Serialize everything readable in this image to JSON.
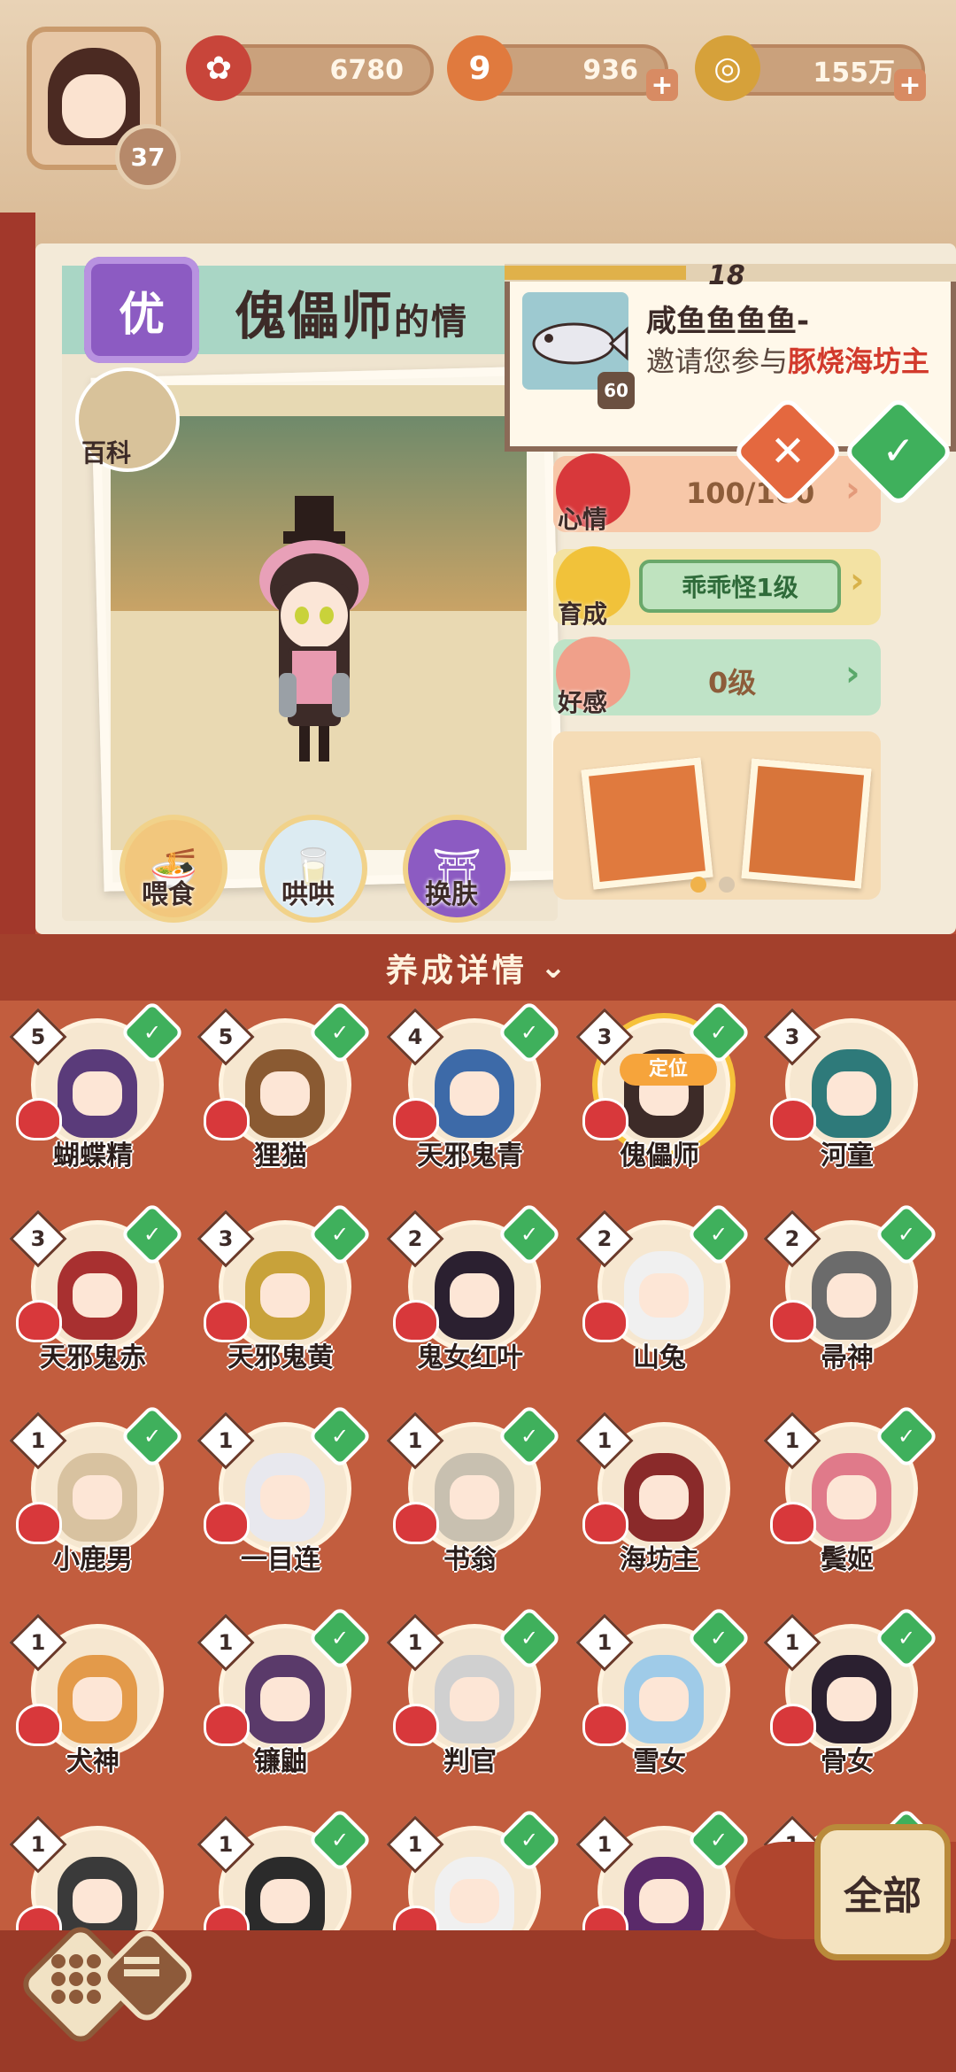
{
  "header": {
    "player_level": "37",
    "resources": [
      {
        "id": "flower",
        "value": "6780",
        "icon": "plum-blossom-icon",
        "color": "#c8453a"
      },
      {
        "id": "nine",
        "value": "936",
        "icon": "nine-badge-icon",
        "color": "#e07a3e"
      },
      {
        "id": "coins",
        "value": "155万",
        "icon": "coin-icon",
        "color": "#d6a13a"
      }
    ]
  },
  "character": {
    "rarity": "优",
    "name": "傀儡师",
    "name_suffix": "的情",
    "encyclopedia": "百科",
    "actions": [
      {
        "label": "喂食",
        "icon": "noodle-bowl-icon",
        "color": "#f2c77d"
      },
      {
        "label": "哄哄",
        "icon": "milk-carton-icon",
        "color": "#dcebf2"
      },
      {
        "label": "换肤",
        "icon": "kimono-icon",
        "color": "#8c5bc2"
      }
    ]
  },
  "notification": {
    "count": "18",
    "avatar_level": "60",
    "sender": "咸鱼鱼鱼鱼-",
    "message_prefix": "邀请您参与",
    "message_highlight": "豚烧海坊主",
    "decline_label": "✕",
    "accept_label": "✓"
  },
  "stats": {
    "mood": {
      "label": "心情",
      "value": "100/100"
    },
    "growth": {
      "label": "育成",
      "value": "乖乖怪1级"
    },
    "affection": {
      "label": "好感",
      "value": "0级"
    }
  },
  "expand_label": "养成详情",
  "locate_label": "定位",
  "roster": [
    {
      "name": "蝴蝶精",
      "stars": "5",
      "checked": true,
      "color": "#5a3b7a"
    },
    {
      "name": "狸猫",
      "stars": "5",
      "checked": true,
      "color": "#8a5a32"
    },
    {
      "name": "天邪鬼青",
      "stars": "4",
      "checked": true,
      "color": "#3d6aa8"
    },
    {
      "name": "傀儡师",
      "stars": "3",
      "checked": true,
      "color": "#3d2b28"
    },
    {
      "name": "河童",
      "stars": "3",
      "checked": false,
      "color": "#2e7a7a"
    },
    {
      "name": "天邪鬼赤",
      "stars": "3",
      "checked": true,
      "color": "#a83030"
    },
    {
      "name": "天邪鬼黄",
      "stars": "3",
      "checked": true,
      "color": "#c8a23a"
    },
    {
      "name": "鬼女红叶",
      "stars": "2",
      "checked": true,
      "color": "#2b2030"
    },
    {
      "name": "山兔",
      "stars": "2",
      "checked": true,
      "color": "#f0f0f0"
    },
    {
      "name": "帚神",
      "stars": "2",
      "checked": true,
      "color": "#6b6b6b"
    },
    {
      "name": "小鹿男",
      "stars": "1",
      "checked": true,
      "color": "#d8c2a0"
    },
    {
      "name": "一目连",
      "stars": "1",
      "checked": true,
      "color": "#e8e8ee"
    },
    {
      "name": "书翁",
      "stars": "1",
      "checked": true,
      "color": "#c8c0b0"
    },
    {
      "name": "海坊主",
      "stars": "1",
      "checked": false,
      "color": "#8a2a2a"
    },
    {
      "name": "鬓姬",
      "stars": "1",
      "checked": true,
      "color": "#e07a8a"
    },
    {
      "name": "犬神",
      "stars": "1",
      "checked": false,
      "color": "#e39a4a"
    },
    {
      "name": "镰鼬",
      "stars": "1",
      "checked": true,
      "color": "#5a3a6a"
    },
    {
      "name": "判官",
      "stars": "1",
      "checked": true,
      "color": "#d0d0d0"
    },
    {
      "name": "雪女",
      "stars": "1",
      "checked": true,
      "color": "#9fcbe8"
    },
    {
      "name": "骨女",
      "stars": "1",
      "checked": true,
      "color": "#2b2030"
    },
    {
      "name": "",
      "stars": "1",
      "checked": false,
      "color": "#3a3a3a"
    },
    {
      "name": "",
      "stars": "1",
      "checked": true,
      "color": "#2b2b2b"
    },
    {
      "name": "",
      "stars": "1",
      "checked": true,
      "color": "#f0f0f0"
    },
    {
      "name": "",
      "stars": "1",
      "checked": true,
      "color": "#5a2a6a"
    },
    {
      "name": "",
      "stars": "1",
      "checked": true,
      "color": "#e07a8a"
    }
  ],
  "bottom": {
    "all_label": "全部"
  }
}
